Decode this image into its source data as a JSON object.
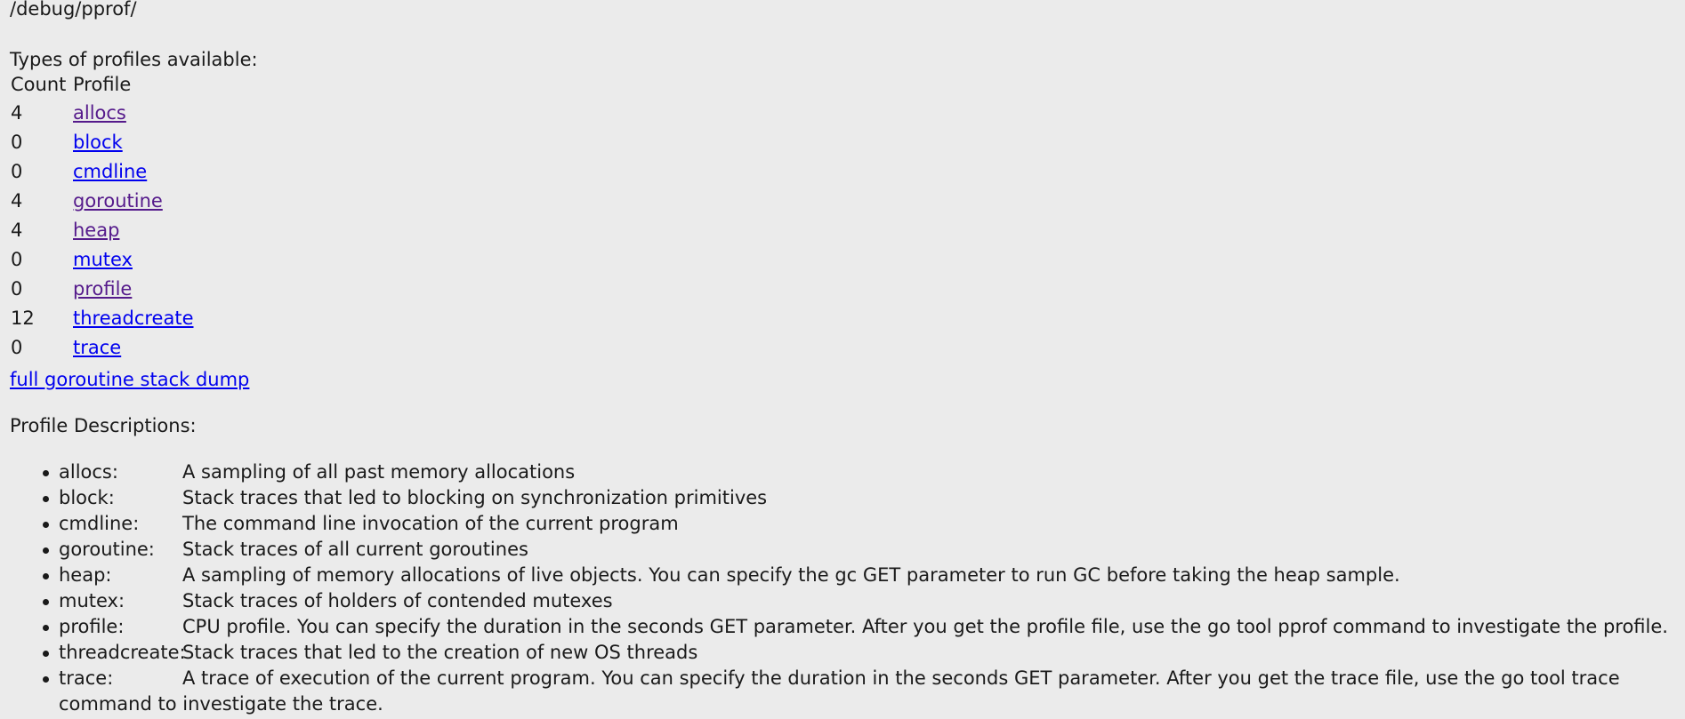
{
  "page": {
    "path": "/debug/pprof/",
    "types_heading": "Types of profiles available:",
    "descriptions_heading": "Profile Descriptions:",
    "full_dump_link": "full goroutine stack dump"
  },
  "table": {
    "headers": [
      "Count",
      "Profile"
    ],
    "rows": [
      {
        "count": "4",
        "profile": "allocs",
        "visited": true
      },
      {
        "count": "0",
        "profile": "block",
        "visited": false
      },
      {
        "count": "0",
        "profile": "cmdline",
        "visited": false
      },
      {
        "count": "4",
        "profile": "goroutine",
        "visited": true
      },
      {
        "count": "4",
        "profile": "heap",
        "visited": true
      },
      {
        "count": "0",
        "profile": "mutex",
        "visited": false
      },
      {
        "count": "0",
        "profile": "profile",
        "visited": true
      },
      {
        "count": "12",
        "profile": "threadcreate",
        "visited": false
      },
      {
        "count": "0",
        "profile": "trace",
        "visited": false
      }
    ]
  },
  "descriptions": [
    {
      "name": "allocs:",
      "text": "A sampling of all past memory allocations"
    },
    {
      "name": "block:",
      "text": "Stack traces that led to blocking on synchronization primitives"
    },
    {
      "name": "cmdline:",
      "text": "The command line invocation of the current program"
    },
    {
      "name": "goroutine:",
      "text": "Stack traces of all current goroutines"
    },
    {
      "name": "heap:",
      "text": "A sampling of memory allocations of live objects. You can specify the gc GET parameter to run GC before taking the heap sample."
    },
    {
      "name": "mutex:",
      "text": "Stack traces of holders of contended mutexes"
    },
    {
      "name": "profile:",
      "text": "CPU profile. You can specify the duration in the seconds GET parameter. After you get the profile file, use the go tool pprof command to investigate the profile."
    },
    {
      "name": "threadcreate:",
      "text": "Stack traces that led to the creation of new OS threads"
    },
    {
      "name": "trace:",
      "text": "A trace of execution of the current program. You can specify the duration in the seconds GET parameter. After you get the trace file, use the go tool trace command to investigate the trace."
    }
  ],
  "colors": {
    "background": "#ebebeb",
    "text": "#1a1a1a",
    "link_unvisited": "#0000ee",
    "link_visited": "#551a8b"
  }
}
